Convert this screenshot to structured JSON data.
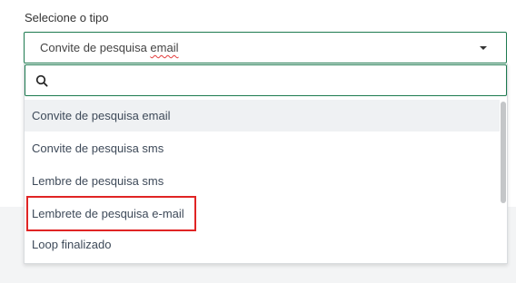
{
  "field": {
    "label": "Selecione o tipo",
    "value_prefix": "Convite de pesquisa ",
    "value_misspelled": "email"
  },
  "search": {
    "value": "",
    "placeholder": ""
  },
  "options": [
    {
      "label": "Convite de pesquisa email",
      "highlighted": true
    },
    {
      "label": "Convite de pesquisa sms",
      "highlighted": false
    },
    {
      "label": "Lembre de pesquisa sms",
      "highlighted": false
    },
    {
      "label": "Lembrete de pesquisa e-mail",
      "highlighted": false,
      "annotated": true
    },
    {
      "label": "Loop finalizado",
      "highlighted": false
    }
  ],
  "colors": {
    "accent": "#1d7a4f",
    "annotation": "#e02424",
    "highlight": "#eff1f3"
  }
}
